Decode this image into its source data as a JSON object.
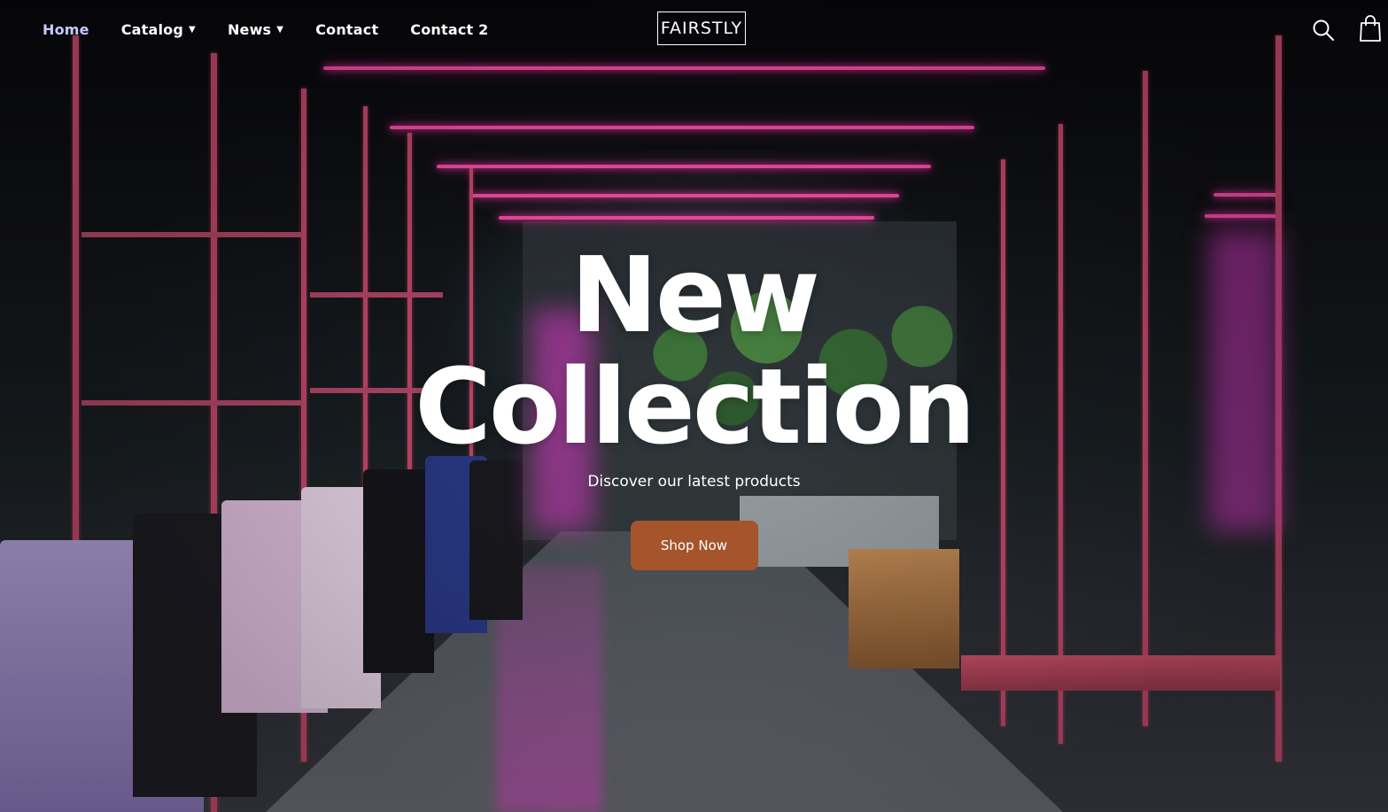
{
  "nav": {
    "items": [
      {
        "label": "Home",
        "active": true,
        "has_dropdown": false
      },
      {
        "label": "Catalog",
        "active": false,
        "has_dropdown": true
      },
      {
        "label": "News",
        "active": false,
        "has_dropdown": true
      },
      {
        "label": "Contact",
        "active": false,
        "has_dropdown": false
      },
      {
        "label": "Contact 2",
        "active": false,
        "has_dropdown": false
      }
    ],
    "dropdown_caret": "▼"
  },
  "brand": {
    "logo_text": "FAIRSTLY"
  },
  "header_icons": [
    "search-icon",
    "shopping-bag-icon"
  ],
  "hero": {
    "title_line1": "New",
    "title_line2": "Collection",
    "subtitle": "Discover our latest products",
    "cta_label": "Shop Now"
  },
  "colors": {
    "nav_active": "#c6c9ff",
    "nav_text": "#ffffff",
    "cta_background": "#a5542c",
    "accent_neon": "#ff4fb0"
  }
}
